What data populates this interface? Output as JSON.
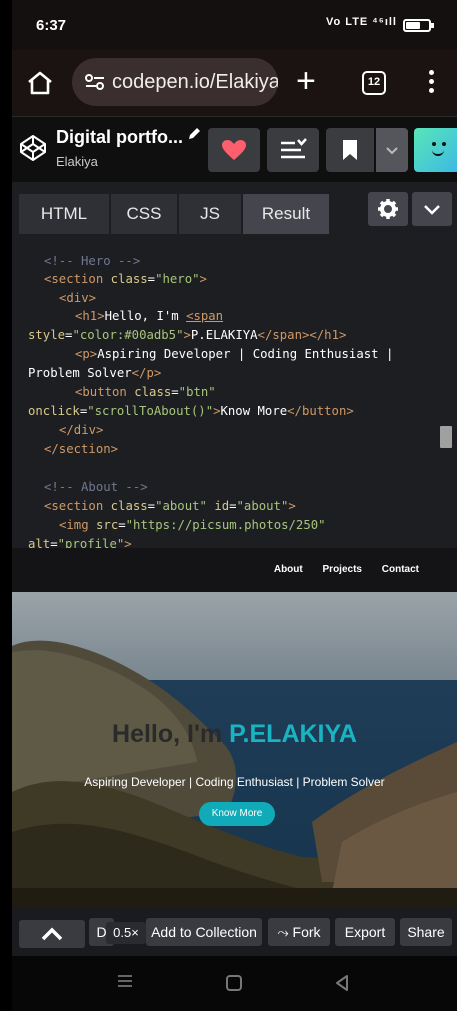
{
  "status": {
    "time": "6:37",
    "signal": "Vo LTE ⁴⁶ıll"
  },
  "browser": {
    "url": "codepen.io/Elakiya",
    "tab_count": "12"
  },
  "pen": {
    "title": "Digital portfo...",
    "author": "Elakiya"
  },
  "editor_tabs": [
    "HTML",
    "CSS",
    "JS",
    "Result"
  ],
  "code": {
    "c1": "<!-- Hero -->",
    "c2": "<!-- About -->",
    "section_open": "<section",
    "section_close": "</section>",
    "class_attr": "class",
    "id_attr": "id",
    "hero_val": "\"hero\"",
    "about_val": "\"about\"",
    "about_id_val": "\"about\"",
    "div_open": "<div>",
    "div_close": "</div>",
    "h1_open": "<h1>",
    "h1_text": "Hello, I'm ",
    "span_open": "<span",
    "style_attr": "style",
    "style_val": "\"color:#00adb5\"",
    "name": "P.ELAKIYA",
    "span_close": "</span>",
    "h1_close": "</h1>",
    "p_open": "<p>",
    "p_text1": "Aspiring Developer | Coding Enthusiast |",
    "p_text2": "Problem Solver",
    "p_close": "</p>",
    "button_open": "<button",
    "btn_val": "\"btn\"",
    "onclick_attr": "onclick",
    "onclick_val": "\"scrollToAbout()\"",
    "button_text": "Know More",
    "button_close": "</button>",
    "img_open": "<img",
    "src_attr": "src",
    "src_val": "\"https://picsum.photos/250\"",
    "alt_attr": "alt",
    "alt_val": "\"profile\""
  },
  "preview": {
    "nav_links": [
      "About",
      "Projects",
      "Contact"
    ],
    "hero_hello": "Hello, I'm ",
    "hero_name": "P.ELAKIYA",
    "hero_sub": "Aspiring Developer | Coding Enthusiast | Problem Solver",
    "hero_button": "Know More",
    "accent": "#00adb5"
  },
  "bottom": {
    "d_label": "D",
    "zoom": "0.5×",
    "add_collection": "Add to Collection",
    "fork": "Fork",
    "export": "Export",
    "share": "Share"
  }
}
